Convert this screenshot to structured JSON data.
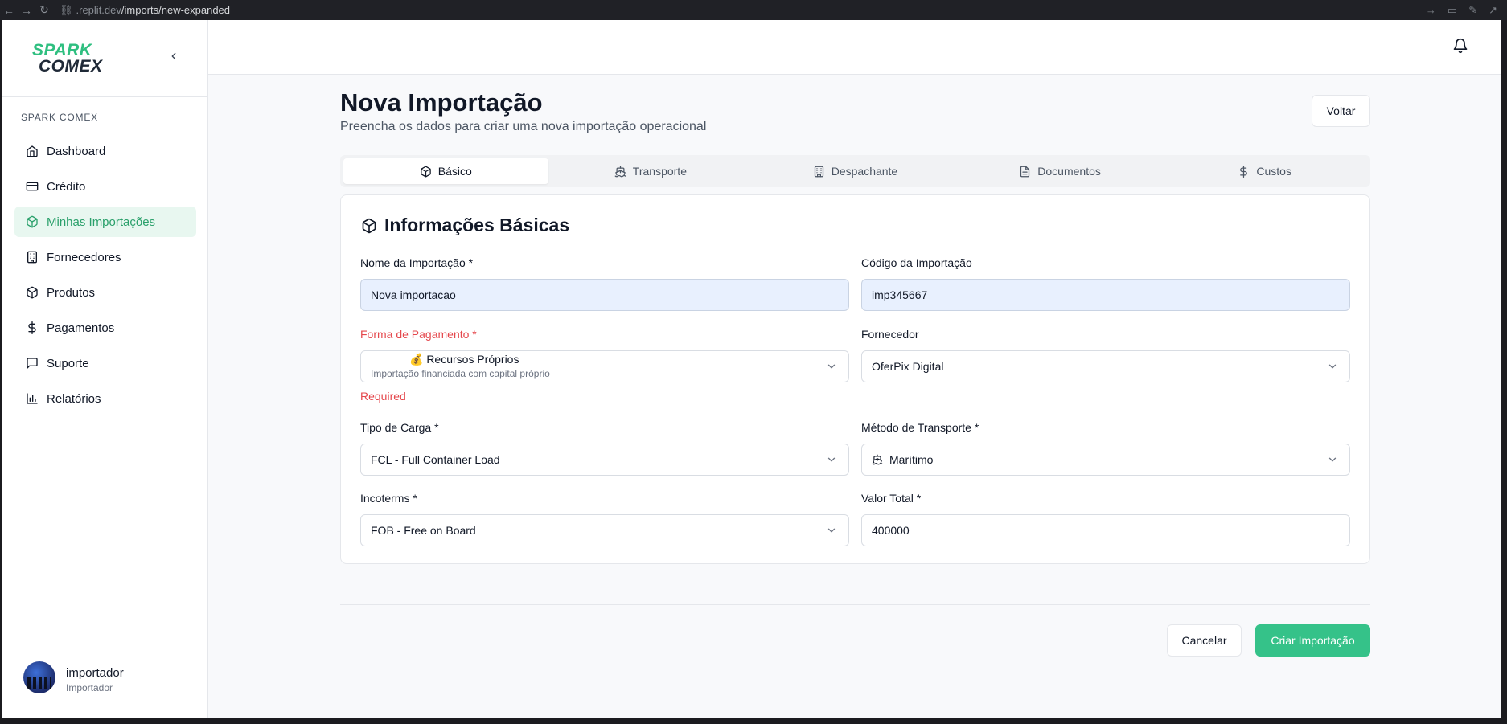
{
  "browser": {
    "url_host": ".replit.dev",
    "url_path": "/imports/new-expanded"
  },
  "sidebar": {
    "logo_line1": "SPARK",
    "logo_line2": "COMEX",
    "section_label": "SPARK COMEX",
    "items": [
      {
        "label": "Dashboard",
        "icon": "home-icon"
      },
      {
        "label": "Crédito",
        "icon": "credit-card-icon"
      },
      {
        "label": "Minhas Importações",
        "icon": "package-icon",
        "active": true
      },
      {
        "label": "Fornecedores",
        "icon": "building-icon"
      },
      {
        "label": "Produtos",
        "icon": "package-icon"
      },
      {
        "label": "Pagamentos",
        "icon": "dollar-icon"
      },
      {
        "label": "Suporte",
        "icon": "message-icon"
      },
      {
        "label": "Relatórios",
        "icon": "bar-chart-icon"
      }
    ],
    "user": {
      "name": "importador",
      "role": "Importador"
    }
  },
  "page": {
    "title": "Nova Importação",
    "subtitle": "Preencha os dados para criar uma nova importação operacional",
    "back_label": "Voltar"
  },
  "tabs": [
    {
      "label": "Básico",
      "icon": "package-icon",
      "active": true
    },
    {
      "label": "Transporte",
      "icon": "ship-icon"
    },
    {
      "label": "Despachante",
      "icon": "building-icon"
    },
    {
      "label": "Documentos",
      "icon": "file-icon"
    },
    {
      "label": "Custos",
      "icon": "dollar-icon"
    }
  ],
  "form": {
    "section_title": "Informações Básicas",
    "nome_label": "Nome da Importação *",
    "nome_value": "Nova importacao",
    "codigo_label": "Código da Importação",
    "codigo_value": "imp345667",
    "pagamento_label": "Forma de Pagamento *",
    "pagamento_value": "💰 Recursos Próprios",
    "pagamento_desc": "Importação financiada com capital próprio",
    "pagamento_error": "Required",
    "fornecedor_label": "Fornecedor",
    "fornecedor_value": "OferPix Digital",
    "carga_label": "Tipo de Carga *",
    "carga_value": "FCL - Full Container Load",
    "transporte_label": "Método de Transporte *",
    "transporte_value": "Marítimo",
    "incoterms_label": "Incoterms *",
    "incoterms_value": "FOB - Free on Board",
    "valor_label": "Valor Total *",
    "valor_value": "400000"
  },
  "actions": {
    "cancel_label": "Cancelar",
    "create_label": "Criar Importação"
  },
  "colors": {
    "accent": "#35c289",
    "error": "#e5484d",
    "active_nav_bg": "#e8f7f0"
  }
}
